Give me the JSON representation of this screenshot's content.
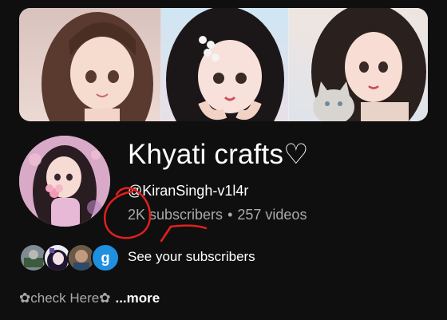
{
  "channel": {
    "name": "Khyati crafts♡",
    "handle": "@KiranSingh-v1l4r",
    "subscribers": "2K subscribers",
    "separator": "•",
    "videos": "257 videos"
  },
  "subscribers_row": {
    "label": "See your subscribers",
    "letter_avatar": "g"
  },
  "description": {
    "text": "✿check Here✿",
    "more_label": "...more"
  },
  "colors": {
    "background": "#0f0f0f",
    "annotation": "#e0201c",
    "letter_avatar": "#1f8fe0"
  }
}
